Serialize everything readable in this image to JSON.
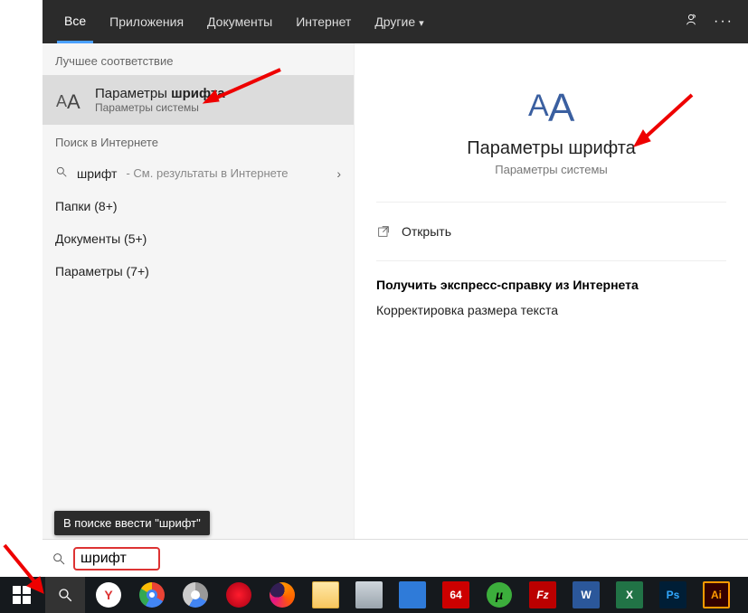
{
  "topbar": {
    "tabs": {
      "all": "Все",
      "apps": "Приложения",
      "docs": "Документы",
      "web": "Интернет",
      "other": "Другие"
    }
  },
  "left": {
    "best_label": "Лучшее соответствие",
    "best_title_pre": "Параметры ",
    "best_title_bold": "шрифта",
    "best_sub": "Параметры системы",
    "web_label": "Поиск в Интернете",
    "web_query": "шрифт",
    "web_hint": " - См. результаты в Интернете",
    "cat_folders": "Папки (8+)",
    "cat_docs": "Документы (5+)",
    "cat_settings": "Параметры (7+)"
  },
  "right": {
    "title": "Параметры шрифта",
    "sub": "Параметры системы",
    "open": "Открыть",
    "help_title": "Получить экспресс-справку из Интернета",
    "help_link": "Корректировка размера текста"
  },
  "tooltip": "В поиске ввести \"шрифт\"",
  "search": {
    "value": "шрифт"
  },
  "taskbar": {
    "yandex": "Y",
    "irfan": "64",
    "utorrent": "µ",
    "filezilla": "Fz",
    "word": "W",
    "excel": "X",
    "ps": "Ps",
    "ai": "Ai"
  }
}
